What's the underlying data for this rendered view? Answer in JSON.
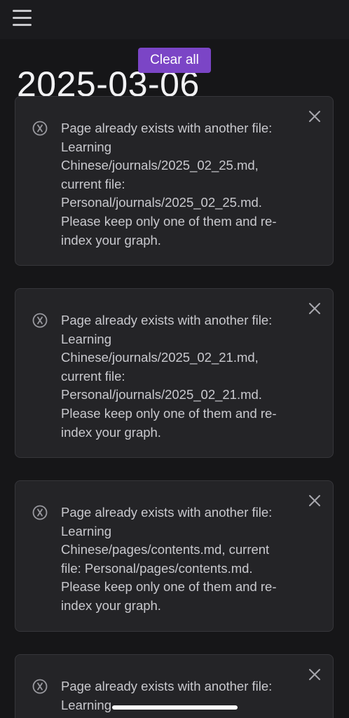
{
  "page": {
    "title": "2025-03-06"
  },
  "toolbar": {
    "clear_all_label": "Clear all"
  },
  "notifications": [
    {
      "message": "Page already exists with another file:\nLearning\nChinese/journals/2025_02_25.md,\ncurrent file:\nPersonal/journals/2025_02_25.md.\nPlease keep only one of them and re-\nindex your graph."
    },
    {
      "message": "Page already exists with another file:\nLearning\nChinese/journals/2025_02_21.md,\ncurrent file:\nPersonal/journals/2025_02_21.md.\nPlease keep only one of them and re-\nindex your graph."
    },
    {
      "message": "Page already exists with another file:\nLearning\nChinese/pages/contents.md, current\nfile: Personal/pages/contents.md.\nPlease keep only one of them and re-\nindex your graph."
    },
    {
      "message": "Page already exists with another file:\nLearning"
    }
  ],
  "icons": {
    "menu": "hamburger-menu-icon",
    "notice": "circle-x-icon",
    "close": "close-icon"
  },
  "colors": {
    "background": "#161618",
    "card": "#242427",
    "accent": "#7b45c6",
    "text": "#c9c9ce"
  }
}
